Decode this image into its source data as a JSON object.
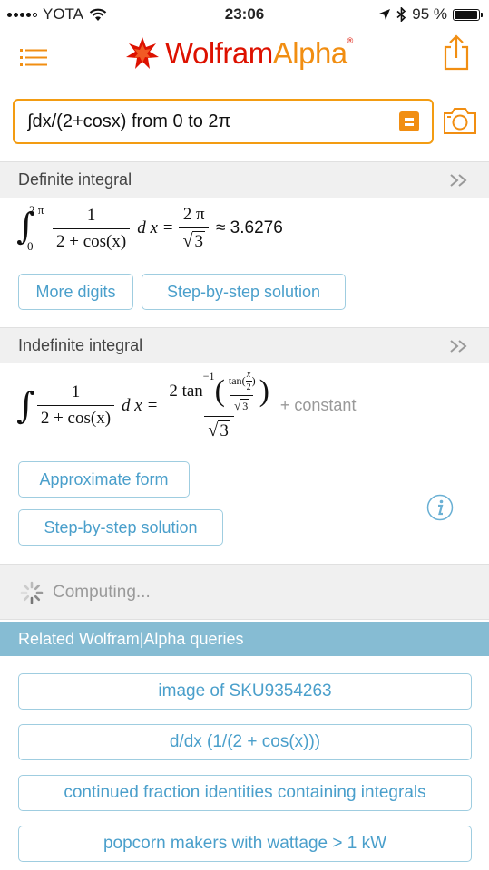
{
  "status_bar": {
    "carrier": "YOTA",
    "time": "23:06",
    "battery_percent": "95 %",
    "battery_level": 0.95,
    "icons": [
      "signal-icon",
      "wifi-icon",
      "location-arrow-icon",
      "bluetooth-icon",
      "battery-icon"
    ]
  },
  "header": {
    "logo_wolfram": "Wolfram",
    "logo_alpha": "Alpha",
    "logo_mark": "®",
    "icons": [
      "menu-icon",
      "wolfram-spikey-logo-icon",
      "share-icon"
    ]
  },
  "search": {
    "value": "∫dx/(2+cosx) from 0 to 2π",
    "icons": [
      "equals-keyboard-icon",
      "camera-icon"
    ]
  },
  "colors": {
    "brand_red": "#dd1100",
    "brand_orange": "#f18e12",
    "button_text": "#4a9fcb",
    "button_border": "#9fcde0",
    "related_bar": "#86bcd3",
    "pod_header": "#f0f0f0"
  },
  "definite": {
    "title": "Definite integral",
    "upper_limit": "2 π",
    "lower_limit": "0",
    "integrand_num": "1",
    "integrand_den": "2 + cos(x)",
    "dx": "d x =",
    "result_num": "2 π",
    "result_den": "3",
    "approx": "≈ 3.6276",
    "buttons": [
      "More digits",
      "Step-by-step solution"
    ]
  },
  "indefinite": {
    "title": "Indefinite integral",
    "integrand_num": "1",
    "integrand_den": "2 + cos(x)",
    "dx": "d x =",
    "result_coef": "2 tan",
    "result_exp": "−1",
    "inner_num": "tan",
    "inner_x": "x",
    "inner_two": "2",
    "inner_den": "3",
    "outer_den": "3",
    "constant": "+ constant",
    "buttons": [
      "Approximate form",
      "Step-by-step solution"
    ]
  },
  "computing": {
    "label": "Computing..."
  },
  "related": {
    "title": "Related Wolfram|Alpha queries",
    "queries": [
      "image of SKU9354263",
      "d/dx (1/(2 + cos(x)))",
      "continued fraction identities containing integrals",
      "popcorn makers with wattage > 1 kW"
    ]
  }
}
